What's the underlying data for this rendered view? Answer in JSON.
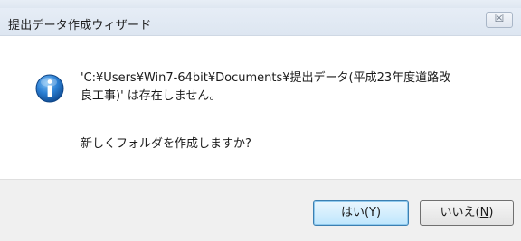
{
  "window": {
    "title": "提出データ作成ウィザード",
    "close_glyph": "☒"
  },
  "message": {
    "icon": "info-icon",
    "line1": "'C:¥Users¥Win7-64bit¥Documents¥提出データ(平成23年度道路改",
    "line2": "良工事)' は存在しません。",
    "question": "新しくフォルダを作成しますか?"
  },
  "buttons": {
    "yes": "はい(Y)",
    "no_prefix": "いいえ(",
    "no_mnemonic": "N",
    "no_suffix": ")"
  },
  "colors": {
    "icon_blue": "#1f6fc3",
    "default_button_border": "#3c7fb1"
  }
}
